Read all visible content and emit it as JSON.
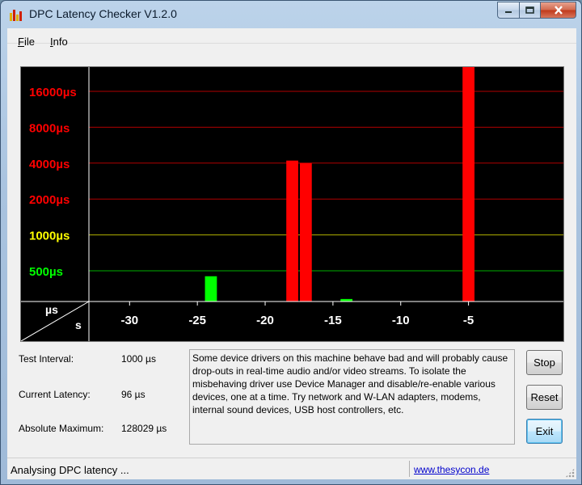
{
  "window": {
    "title": "DPC Latency Checker V1.2.0",
    "caption_buttons": {
      "minimize_icon": "minimize-icon",
      "maximize_icon": "maximize-icon",
      "close_icon": "close-icon"
    }
  },
  "menu": {
    "items": [
      {
        "label": "File",
        "accel": "F",
        "rest": "ile"
      },
      {
        "label": "Info",
        "accel": "I",
        "rest": "nfo"
      }
    ]
  },
  "chart_data": {
    "type": "bar",
    "y_scale": "log",
    "unit_label": "µs",
    "axis_corner": {
      "top": "µs",
      "bottom": "s"
    },
    "y_ticks": [
      {
        "value": 16000,
        "label": "16000µs",
        "color": "#ff0000"
      },
      {
        "value": 8000,
        "label": "8000µs",
        "color": "#ff0000"
      },
      {
        "value": 4000,
        "label": "4000µs",
        "color": "#ff0000"
      },
      {
        "value": 2000,
        "label": "2000µs",
        "color": "#ff0000"
      },
      {
        "value": 1000,
        "label": "1000µs",
        "color": "#ffff00"
      },
      {
        "value": 500,
        "label": "500µs",
        "color": "#00ff00"
      }
    ],
    "x_ticks": [
      -30,
      -25,
      -20,
      -15,
      -10,
      -5
    ],
    "x_tick_labels": [
      "-30",
      "-25",
      "-20",
      "-15",
      "-10",
      "-5"
    ],
    "x_range": [
      -33,
      2
    ],
    "bar_times": [
      -32,
      -31,
      -30,
      -29,
      -28,
      -27,
      -26,
      -25,
      -24,
      -23,
      -22,
      -21,
      -20,
      -19,
      -18,
      -17,
      -16,
      -15,
      -14,
      -13,
      -12,
      -11,
      -10,
      -9,
      -8,
      -7,
      -6,
      -5,
      -4,
      -3,
      -2,
      -1,
      0
    ],
    "values": [
      110,
      100,
      110,
      95,
      95,
      100,
      95,
      90,
      450,
      80,
      70,
      80,
      100,
      230,
      4200,
      4000,
      70,
      100,
      290,
      85,
      80,
      95,
      80,
      80,
      85,
      80,
      190,
      128029,
      130,
      100,
      120,
      120,
      95,
      140
    ],
    "green_max": 1000,
    "colors": {
      "background": "#000000",
      "normal": "#00ff00",
      "critical": "#ff0000",
      "axis": "#ffffff"
    }
  },
  "info": {
    "test_interval": {
      "label": "Test Interval:",
      "value": "1000 µs"
    },
    "current_latency": {
      "label": "Current Latency:",
      "value": "96 µs"
    },
    "absolute_maximum": {
      "label": "Absolute Maximum:",
      "value": "128029 µs"
    }
  },
  "message": "Some device drivers on this machine behave bad and will probably cause drop-outs in real-time audio and/or video streams. To isolate the misbehaving driver use Device Manager and disable/re-enable various devices, one at a time. Try network and W-LAN adapters, modems, internal sound devices, USB host controllers, etc.",
  "buttons": {
    "stop": "Stop",
    "reset": "Reset",
    "exit": "Exit"
  },
  "status": {
    "text": "Analysing DPC latency ...",
    "link": "www.thesycon.de"
  }
}
